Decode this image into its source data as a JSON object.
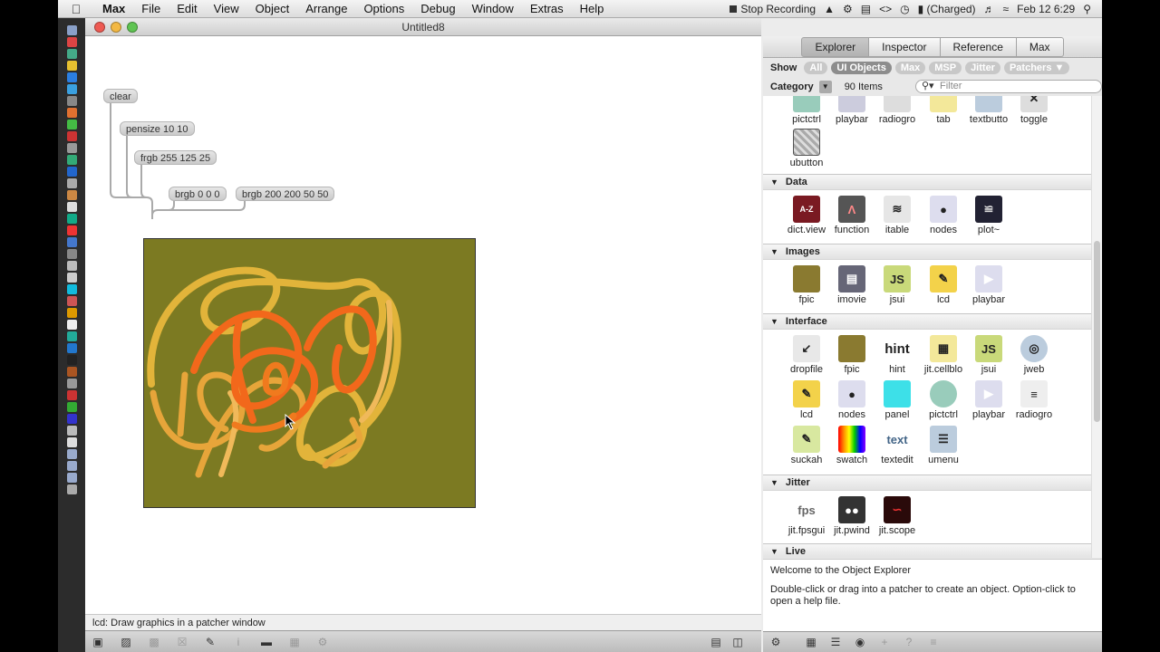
{
  "menubar": {
    "app": "Max",
    "menus": [
      "File",
      "Edit",
      "View",
      "Object",
      "Arrange",
      "Options",
      "Debug",
      "Window",
      "Extras",
      "Help"
    ],
    "stop_recording": "Stop Recording",
    "battery": "(Charged)",
    "clock": "Feb 12  6:29"
  },
  "patcher": {
    "title": "Untitled8",
    "objects": {
      "clear": "clear",
      "pensize": "pensize 10 10",
      "frgb": "frgb 255 125 25",
      "brgb1": "brgb 0 0 0",
      "brgb2": "brgb 200 200 50 50"
    },
    "lcd_background": "#7c7a22",
    "status": "lcd: Draw graphics in a patcher window"
  },
  "explorer": {
    "tabs": [
      "Explorer",
      "Inspector",
      "Reference",
      "Max"
    ],
    "active_tab": "Explorer",
    "show_label": "Show",
    "filters": [
      "All",
      "UI Objects",
      "Max",
      "MSP",
      "Jitter",
      "Patchers ▼"
    ],
    "active_filter": "UI Objects",
    "category_label": "Category",
    "item_count": "90 Items",
    "filter_placeholder": "Filter",
    "top_items": [
      "pictctrl",
      "playbar",
      "radiogro",
      "tab",
      "textbutto",
      "toggle",
      "ubutton"
    ],
    "sections": {
      "data": {
        "title": "Data",
        "items": [
          "dict.view",
          "function",
          "itable",
          "nodes",
          "plot~"
        ]
      },
      "images": {
        "title": "Images",
        "items": [
          "fpic",
          "imovie",
          "jsui",
          "lcd",
          "playbar"
        ]
      },
      "interface": {
        "title": "Interface",
        "items": [
          "dropfile",
          "fpic",
          "hint",
          "jit.cellblo",
          "jsui",
          "jweb",
          "lcd",
          "nodes",
          "panel",
          "pictctrl",
          "playbar",
          "radiogro",
          "suckah",
          "swatch",
          "textedit",
          "umenu"
        ]
      },
      "jitter": {
        "title": "Jitter",
        "items": [
          "jit.fpsgui",
          "jit.pwind",
          "jit.scope"
        ]
      },
      "live": {
        "title": "Live"
      }
    },
    "icons": {
      "hint_text": "hint",
      "jsui_text": "JS",
      "fps_text": "fps",
      "textedit_text": "text"
    },
    "description": {
      "line1": "Welcome to the Object Explorer",
      "line2": "Double-click or drag into a patcher to create an object. Option-click to open a help file."
    }
  }
}
